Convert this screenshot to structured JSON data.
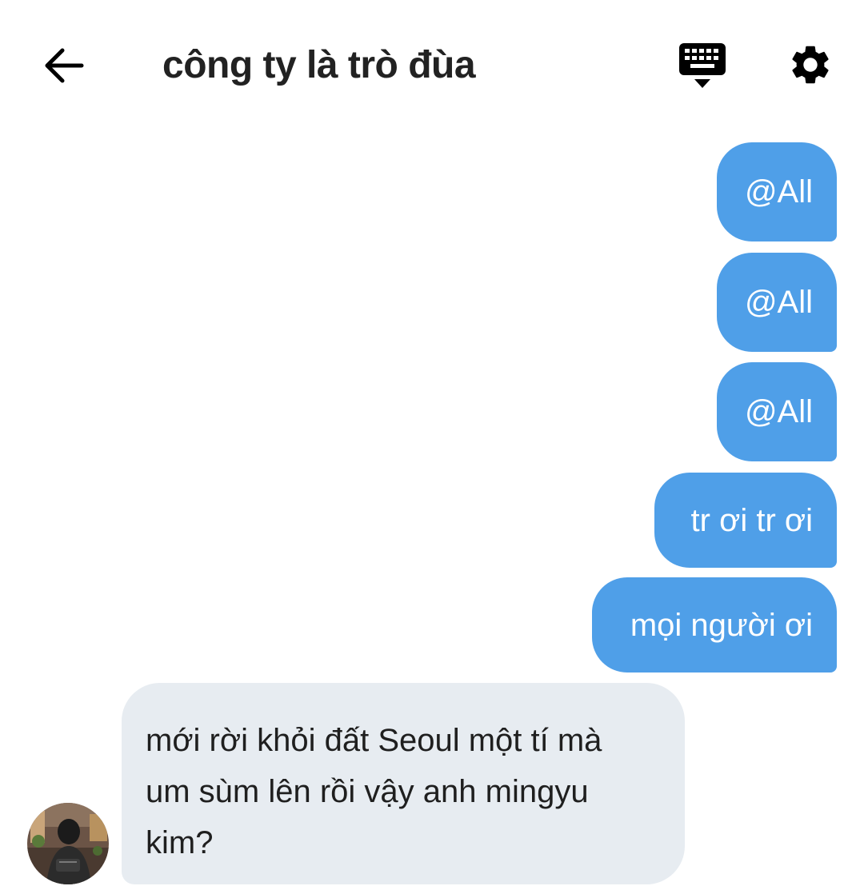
{
  "header": {
    "title": "công ty là trò đùa",
    "back_icon": "arrow-left-icon",
    "keyboard_icon": "keyboard-hide-icon",
    "settings_icon": "gear-icon"
  },
  "messages_out": [
    {
      "text": "@All"
    },
    {
      "text": "@All"
    },
    {
      "text": "@All"
    },
    {
      "text": "tr ơi tr ơi"
    },
    {
      "text": "mọi người ơi"
    }
  ],
  "message_in": {
    "lines": [
      "mới rời khỏi đất Seoul một tí mà",
      "um sùm lên rồi vậy anh mingyu",
      "kim?"
    ],
    "avatar_icon": "user-avatar"
  },
  "colors": {
    "outgoing_bubble": "#4f9fe8",
    "incoming_bubble": "#e7ecf1",
    "icon": "#000000"
  }
}
